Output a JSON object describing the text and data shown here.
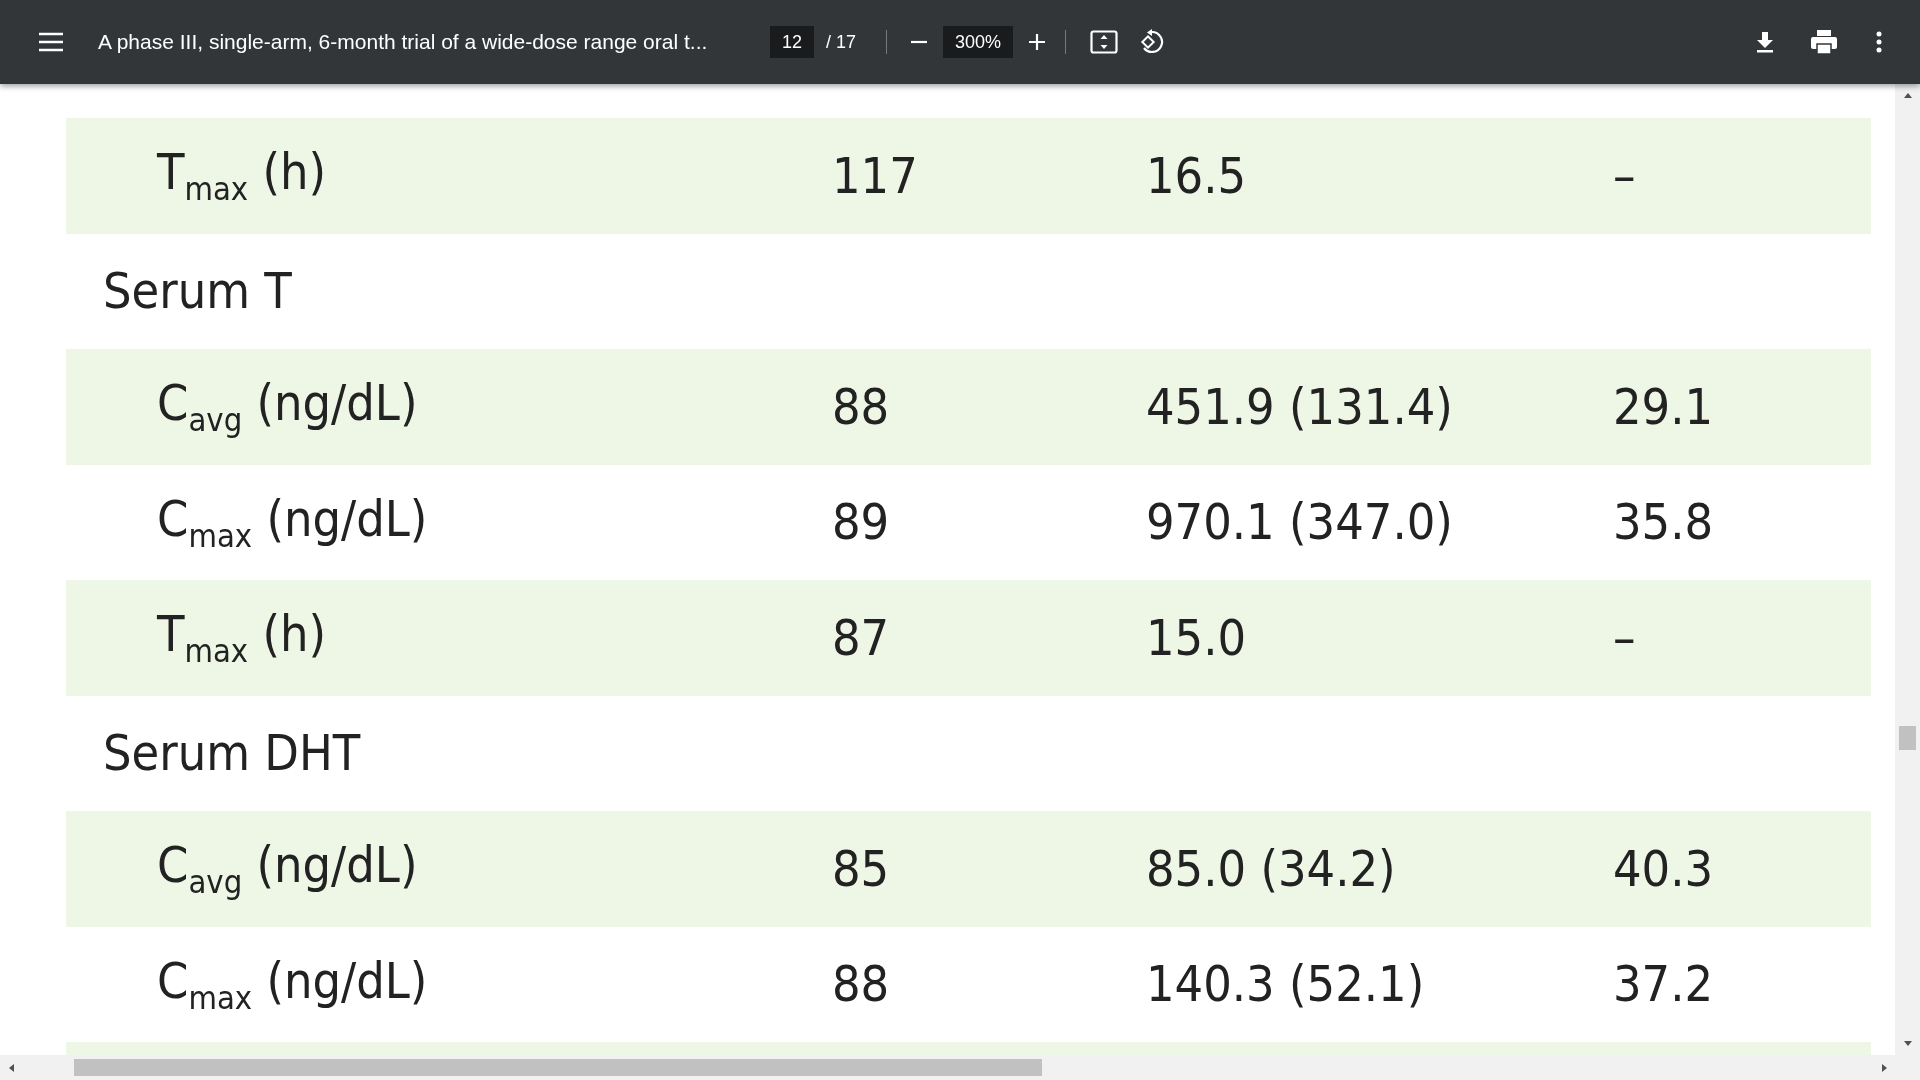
{
  "toolbar": {
    "title": "A phase III, single-arm, 6-month trial of a wide-dose range oral t...",
    "page": "12",
    "page_count": "/ 17",
    "zoom": "300%"
  },
  "table": {
    "rows": [
      {
        "kind": "param",
        "label": "T$_{max}$ (h)",
        "n": "117",
        "value": "16.5",
        "cv": "–"
      },
      {
        "kind": "section",
        "label": "Serum T"
      },
      {
        "kind": "param",
        "label": "C$_{avg}$ (ng/dL)",
        "n": "88",
        "value": "451.9 (131.4)",
        "cv": "29.1"
      },
      {
        "kind": "param",
        "label": "C$_{max}$ (ng/dL)",
        "n": "89",
        "value": "970.1 (347.0)",
        "cv": "35.8"
      },
      {
        "kind": "param",
        "label": "T$_{max}$ (h)",
        "n": "87",
        "value": "15.0",
        "cv": "–"
      },
      {
        "kind": "section",
        "label": "Serum DHT"
      },
      {
        "kind": "param",
        "label": "C$_{avg}$ (ng/dL)",
        "n": "85",
        "value": "85.0 (34.2)",
        "cv": "40.3"
      },
      {
        "kind": "param",
        "label": "C$_{max}$ (ng/dL)",
        "n": "88",
        "value": "140.3 (52.1)",
        "cv": "37.2"
      }
    ]
  }
}
